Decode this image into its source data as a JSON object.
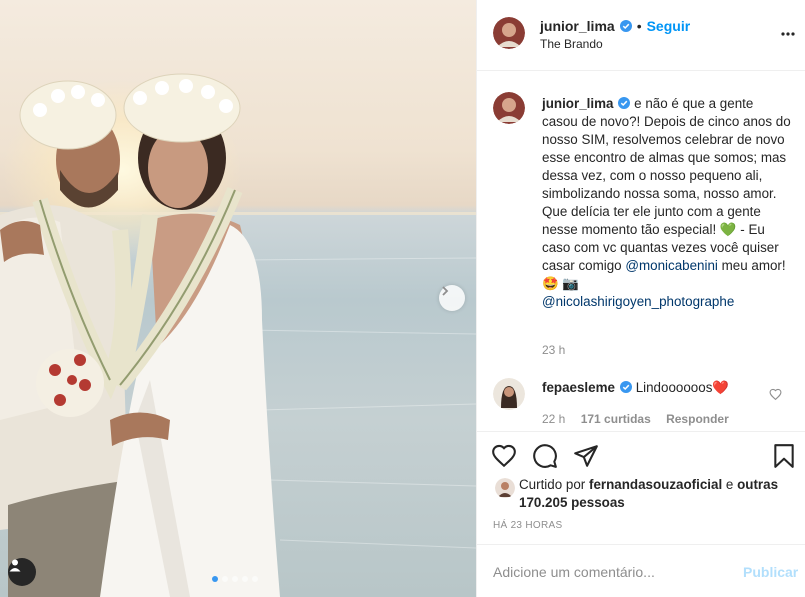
{
  "post": {
    "author": "junior_lima",
    "follow_label": "Seguir",
    "location": "The Brando",
    "caption": {
      "username": "junior_lima",
      "text_before": "e não é que a gente casou de novo?! Depois de cinco anos do nosso SIM, resolvemos celebrar de novo esse encontro de almas que somos; mas dessa vez, com o nosso pequeno ali, simbolizando nossa soma, nosso amor. Que delícia ter ele junto com a gente nesse momento tão especial! 💚 - Eu caso com vc quantas vezes você quiser casar comigo",
      "mention1": "@monicabenini",
      "text_after": "meu amor! 🤩 📷",
      "mention2": "@nicolashirigoyen_photographe",
      "time": "23 h"
    },
    "comment": {
      "username": "fepaesleme",
      "text": "Lindoooooos❤️",
      "time": "22 h",
      "likes": "171 curtidas",
      "reply": "Responder"
    },
    "likes_line": {
      "prefix": "Curtido por",
      "user": "fernandasouzaoficial",
      "mid": "e",
      "others": "outras 170.205 pessoas"
    },
    "posted_ago": "HÁ 23 HORAS",
    "add_comment_placeholder": "Adicione um comentário...",
    "publish_label": "Publicar",
    "carousel": {
      "slides": 5,
      "active": 1
    }
  },
  "colors": {
    "verified": "#3897f0",
    "follow": "#0095f6",
    "mention": "#00376b",
    "muted": "#8e8e8e",
    "publish_disabled": "#b2dffc",
    "dot_active": "#3897f0"
  },
  "icons": [
    "verified-badge-icon",
    "more-options-icon",
    "heart-icon",
    "comment-icon",
    "share-icon",
    "bookmark-icon",
    "user-tag-icon",
    "chevron-right-icon"
  ]
}
